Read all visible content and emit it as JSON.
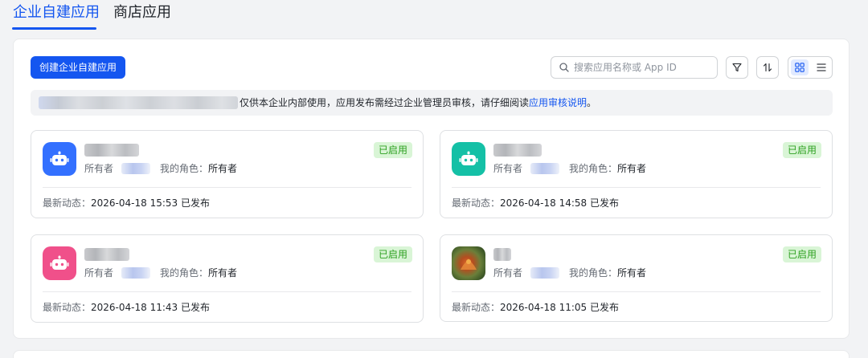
{
  "tabs": [
    {
      "label": "企业自建应用",
      "active": true
    },
    {
      "label": "商店应用",
      "active": false
    }
  ],
  "toolbar": {
    "create_label": "创建企业自建应用",
    "search_placeholder": "搜索应用名称或 App ID",
    "filter_icon": "filter-icon",
    "sort_icon": "sort-icon",
    "view_grid_icon": "grid-view-icon",
    "view_list_icon": "list-view-icon"
  },
  "notice": {
    "text": "仅供本企业内部使用，应用发布需经过企业管理员审核，请仔细阅读",
    "link": "应用审核说明",
    "end": "。"
  },
  "cards": [
    {
      "icon": "robot-icon",
      "icon_color": "#3370ff",
      "owner_label": "所有者",
      "role_label": "我的角色：",
      "role_value": "所有者",
      "status": "已启用",
      "latest_label": "最新动态：",
      "latest_value": "2026-04-18 15:53 已发布"
    },
    {
      "icon": "robot-icon",
      "icon_color": "#14c0a6",
      "owner_label": "所有者",
      "role_label": "我的角色：",
      "role_value": "所有者",
      "status": "已启用",
      "latest_label": "最新动态：",
      "latest_value": "2026-04-18 14:58 已发布"
    },
    {
      "icon": "robot-icon",
      "icon_color": "#f0508a",
      "owner_label": "所有者",
      "role_label": "我的角色：",
      "role_value": "所有者",
      "status": "已启用",
      "latest_label": "最新动态：",
      "latest_value": "2026-04-18 11:43 已发布"
    },
    {
      "icon": "photo-icon",
      "icon_color": "#b54d1f",
      "owner_label": "所有者",
      "role_label": "我的角色：",
      "role_value": "所有者",
      "status": "已启用",
      "latest_label": "最新动态：",
      "latest_value": "2026-04-18 11:05 已发布"
    }
  ],
  "colors": {
    "accent": "#1456f0",
    "status_bg": "#d9f5d6",
    "status_text": "#2ea121"
  }
}
